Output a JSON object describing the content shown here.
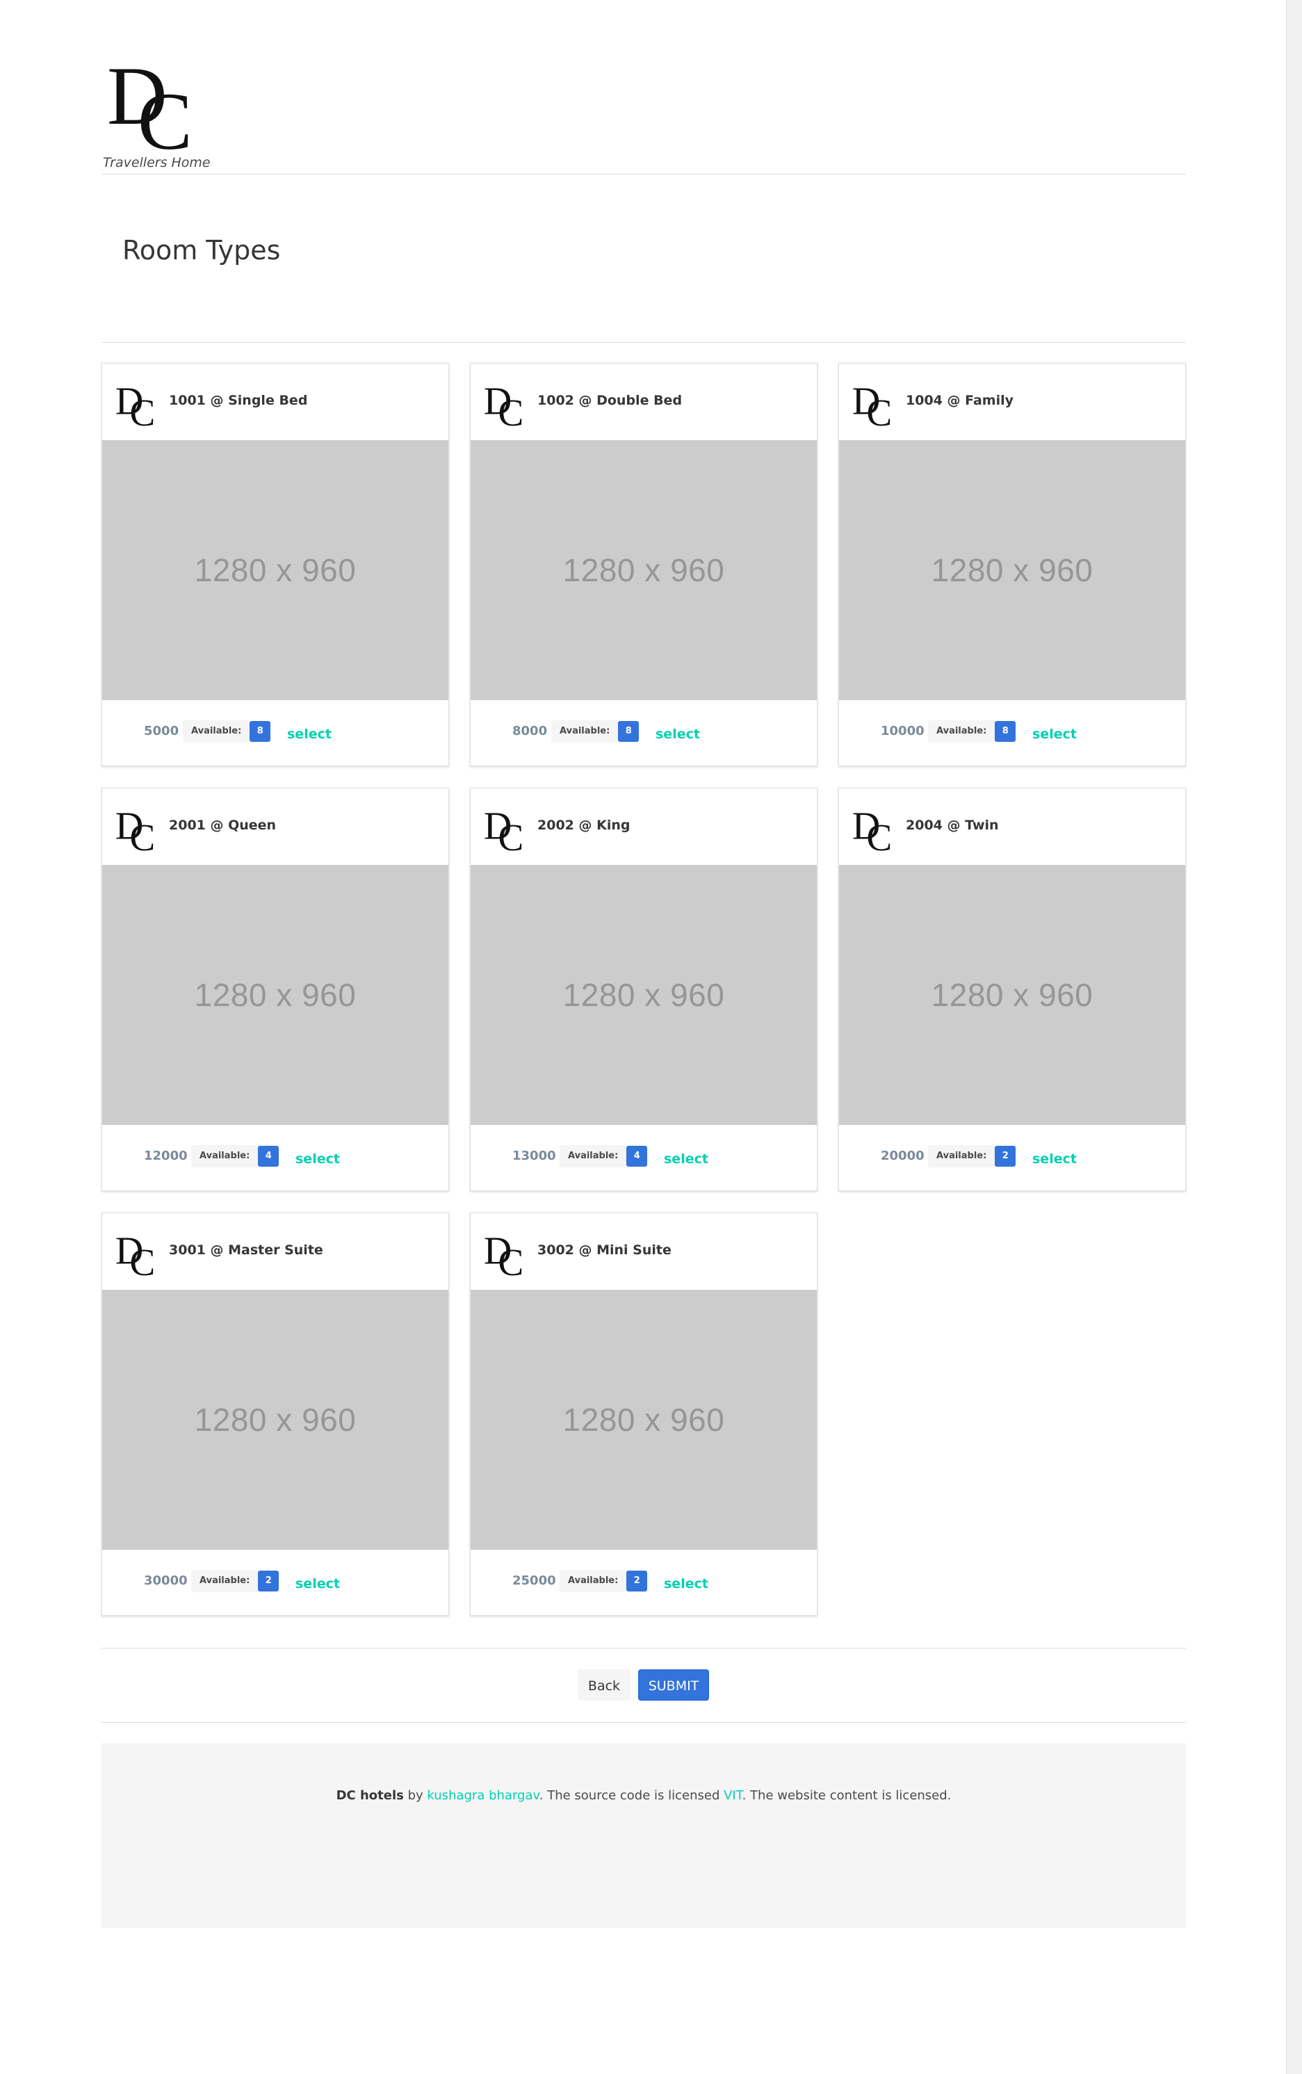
{
  "header": {
    "logo_text": "DC",
    "tagline": "Travellers Home"
  },
  "page_title": "Room Types",
  "rooms": [
    {
      "title": "1001 @ Single Bed",
      "image_label": "1280 x 960",
      "price": "5000",
      "available_label": "Available:",
      "available": "8",
      "select_label": "select"
    },
    {
      "title": "1002 @ Double Bed",
      "image_label": "1280 x 960",
      "price": "8000",
      "available_label": "Available:",
      "available": "8",
      "select_label": "select"
    },
    {
      "title": "1004 @ Family",
      "image_label": "1280 x 960",
      "price": "10000",
      "available_label": "Available:",
      "available": "8",
      "select_label": "select"
    },
    {
      "title": "2001 @ Queen",
      "image_label": "1280 x 960",
      "price": "12000",
      "available_label": "Available:",
      "available": "4",
      "select_label": "select"
    },
    {
      "title": "2002 @ King",
      "image_label": "1280 x 960",
      "price": "13000",
      "available_label": "Available:",
      "available": "4",
      "select_label": "select"
    },
    {
      "title": "2004 @ Twin",
      "image_label": "1280 x 960",
      "price": "20000",
      "available_label": "Available:",
      "available": "2",
      "select_label": "select"
    },
    {
      "title": "3001 @ Master Suite",
      "image_label": "1280 x 960",
      "price": "30000",
      "available_label": "Available:",
      "available": "2",
      "select_label": "select"
    },
    {
      "title": "3002 @ Mini Suite",
      "image_label": "1280 x 960",
      "price": "25000",
      "available_label": "Available:",
      "available": "2",
      "select_label": "select"
    }
  ],
  "actions": {
    "back_label": "Back",
    "submit_label": "SUBMIT"
  },
  "footer": {
    "brand": "DC hotels",
    "by": " by ",
    "author": "kushagra bhargav",
    "license_text": ". The source code is licensed ",
    "license_link": "VIT",
    "content_text": ". The website content is licensed."
  },
  "colors": {
    "primary": "#3273dc",
    "link": "#00d1b2",
    "placeholder_bg": "#cccccc",
    "footer_bg": "#f5f5f5"
  }
}
